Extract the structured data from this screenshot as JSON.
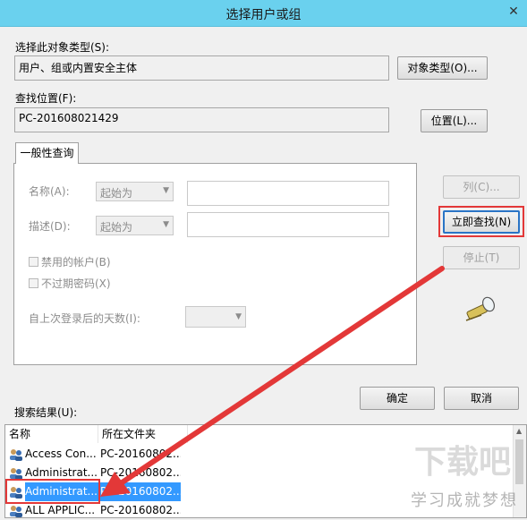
{
  "window": {
    "title": "选择用户或组",
    "close": "✕"
  },
  "object_type": {
    "label": "选择此对象类型(S):",
    "value": "用户、组或内置安全主体",
    "button": "对象类型(O)..."
  },
  "location": {
    "label": "查找位置(F):",
    "value": "PC-201608021429",
    "button": "位置(L)..."
  },
  "tab": {
    "label": "一般性查询"
  },
  "query": {
    "name_label": "名称(A):",
    "name_mode": "起始为",
    "desc_label": "描述(D):",
    "desc_mode": "起始为",
    "disabled_accounts": "禁用的帐户(B)",
    "non_expiring_pwd": "不过期密码(X)",
    "days_since_login": "自上次登录后的天数(I):"
  },
  "buttons": {
    "columns": "列(C)...",
    "find_now": "立即查找(N)",
    "stop": "停止(T)",
    "ok": "确定",
    "cancel": "取消"
  },
  "results": {
    "label": "搜索结果(U):",
    "headers": {
      "name": "名称",
      "folder": "所在文件夹"
    },
    "rows": [
      {
        "name": "Access Con...",
        "folder": "PC-20160802..."
      },
      {
        "name": "Administrat...",
        "folder": "PC-20160802..."
      },
      {
        "name": "Administrat...",
        "folder": "PC-20160802..."
      },
      {
        "name": "ALL APPLIC...",
        "folder": "PC-20160802..."
      }
    ],
    "selected_index": 2
  },
  "watermark": {
    "text": "学习成就梦想",
    "logo": "下载吧"
  },
  "colors": {
    "titlebar": "#6ad1ee",
    "highlight": "#e33838",
    "selection": "#3399ff"
  }
}
